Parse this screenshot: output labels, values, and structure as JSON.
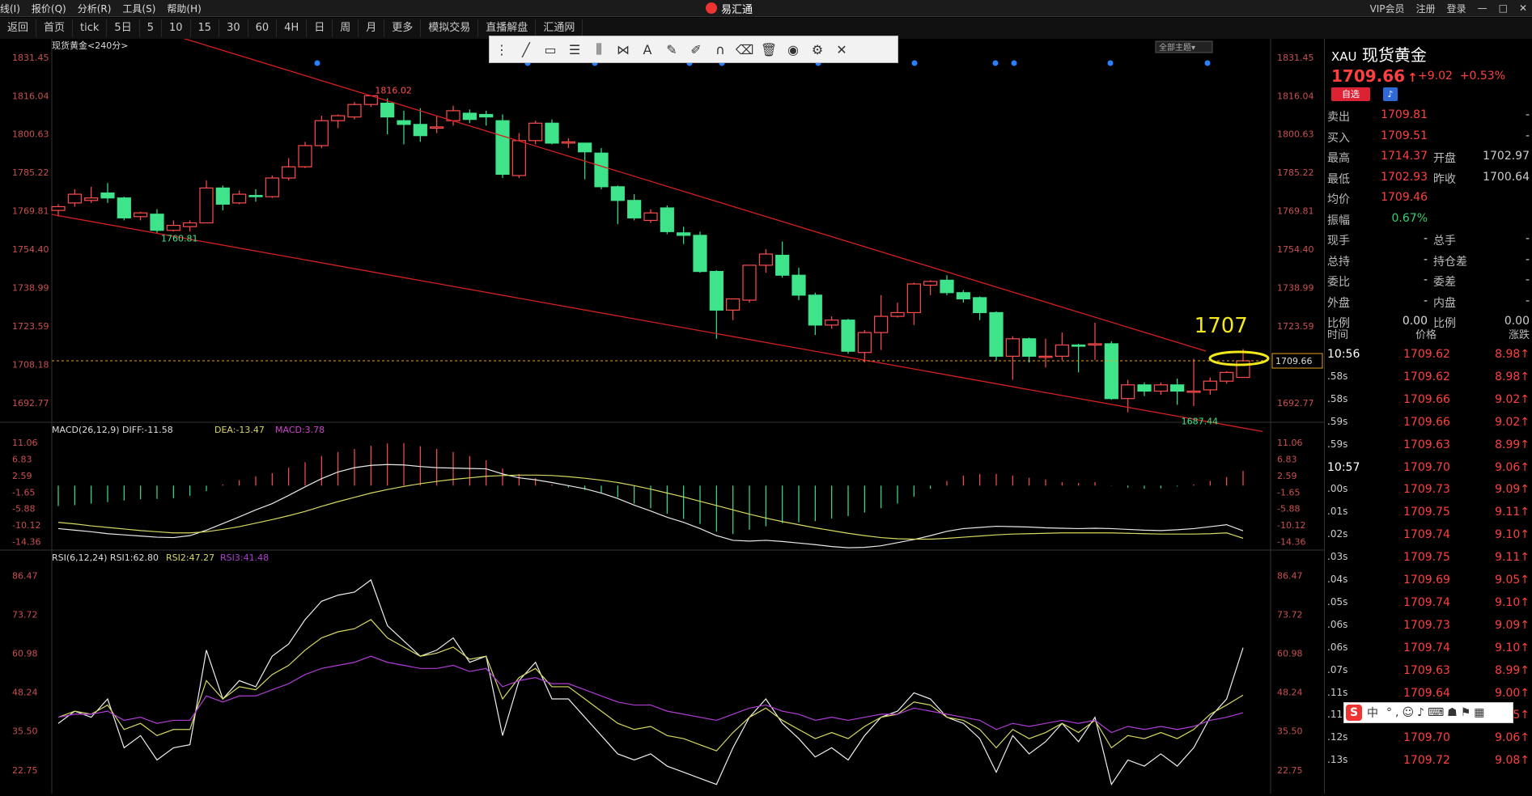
{
  "menu": [
    "线(I)",
    "报价(Q)",
    "分析(R)",
    "工具(S)",
    "帮助(H)"
  ],
  "app_title": "易汇通",
  "top_right": [
    "VIP会员",
    "注册",
    "登录"
  ],
  "toolbar": [
    "返回",
    "首页",
    "tick",
    "5日",
    "5",
    "10",
    "15",
    "30",
    "60",
    "4H",
    "日",
    "周",
    "月",
    "更多",
    "模拟交易",
    "直播解盘",
    "汇通网"
  ],
  "chart": {
    "title": "现货黄金<240分>",
    "main_y_ticks": [
      "1831.45",
      "1816.04",
      "1800.63",
      "1785.22",
      "1769.81",
      "1754.40",
      "1738.99",
      "1723.59",
      "1708.18",
      "1692.77"
    ],
    "current_price_label": "1709.66",
    "annotation": "1707",
    "high_label": "1816.02",
    "low_labels": [
      "1760.81",
      "1687.44"
    ],
    "theme_btn": "全部主题",
    "macd_header": {
      "name": "MACD(26,12,9)",
      "diff": "DIFF:-11.58",
      "dea": "DEA:-13.47",
      "macd": "MACD:3.78"
    },
    "macd_y_ticks": [
      "11.06",
      "6.83",
      "2.59",
      "-1.65",
      "-5.88",
      "-10.12",
      "-14.36"
    ],
    "rsi_header": {
      "name": "RSI(6,12,24)",
      "rsi1": "RSI1:62.80",
      "rsi2": "RSI2:47.27",
      "rsi3": "RSI3:41.48"
    },
    "rsi_y_ticks": [
      "86.47",
      "73.72",
      "60.98",
      "48.24",
      "35.50",
      "22.75"
    ],
    "colors": {
      "up": "#ff4d4d",
      "down": "#3ee38a",
      "line": "#d42020",
      "dea": "#d8d860",
      "rsi3": "#b03cd6"
    }
  },
  "chart_data": {
    "type": "candlestick",
    "title": "现货黄金<240分>",
    "ylim": [
      1685,
      1833
    ],
    "candles": [
      [
        1770.0,
        1771.5,
        1767.5,
        1772.5
      ],
      [
        1773.0,
        1776.5,
        1771.5,
        1778.5
      ],
      [
        1774.0,
        1775.0,
        1773.0,
        1779.5
      ],
      [
        1777.0,
        1775.0,
        1773.0,
        1781.0
      ],
      [
        1775.0,
        1767.0,
        1766.0,
        1775.5
      ],
      [
        1767.5,
        1769.0,
        1766.0,
        1769.5
      ],
      [
        1768.5,
        1762.0,
        1760.81,
        1770.5
      ],
      [
        1762.0,
        1764.0,
        1761.5,
        1766.0
      ],
      [
        1763.5,
        1765.0,
        1761.5,
        1766.0
      ],
      [
        1765.0,
        1779.0,
        1765.0,
        1782.0
      ],
      [
        1779.0,
        1772.5,
        1770.0,
        1780.0
      ],
      [
        1773.0,
        1776.5,
        1772.5,
        1778.0
      ],
      [
        1776.0,
        1775.5,
        1773.5,
        1778.5
      ],
      [
        1775.5,
        1783.0,
        1775.0,
        1784.0
      ],
      [
        1783.0,
        1787.5,
        1782.0,
        1791.0
      ],
      [
        1787.5,
        1796.0,
        1787.0,
        1797.5
      ],
      [
        1796.0,
        1806.0,
        1795.0,
        1808.0
      ],
      [
        1806.0,
        1808.0,
        1803.0,
        1808.5
      ],
      [
        1807.5,
        1812.5,
        1806.5,
        1813.5
      ],
      [
        1812.5,
        1816.0,
        1811.5,
        1816.02
      ],
      [
        1813.0,
        1807.5,
        1800.5,
        1815.0
      ],
      [
        1806.0,
        1804.5,
        1796.5,
        1810.0
      ],
      [
        1804.5,
        1800.0,
        1797.5,
        1811.0
      ],
      [
        1803.0,
        1803.5,
        1801.0,
        1808.0
      ],
      [
        1806.0,
        1810.0,
        1804.0,
        1812.0
      ],
      [
        1809.0,
        1806.5,
        1805.0,
        1810.5
      ],
      [
        1808.5,
        1807.5,
        1804.0,
        1810.0
      ],
      [
        1806.0,
        1784.5,
        1783.0,
        1808.5
      ],
      [
        1784.0,
        1798.0,
        1783.0,
        1801.0
      ],
      [
        1798.0,
        1805.0,
        1796.5,
        1806.0
      ],
      [
        1805.0,
        1797.0,
        1796.5,
        1806.5
      ],
      [
        1797.0,
        1797.5,
        1795.0,
        1799.0
      ],
      [
        1797.0,
        1793.5,
        1782.5,
        1797.0
      ],
      [
        1793.0,
        1779.5,
        1778.5,
        1795.0
      ],
      [
        1779.5,
        1774.0,
        1764.5,
        1780.0
      ],
      [
        1774.0,
        1767.0,
        1766.0,
        1776.5
      ],
      [
        1766.0,
        1769.0,
        1765.0,
        1770.5
      ],
      [
        1771.0,
        1761.5,
        1760.5,
        1772.0
      ],
      [
        1761.0,
        1760.0,
        1756.5,
        1763.5
      ],
      [
        1760.0,
        1745.5,
        1745.0,
        1761.5
      ],
      [
        1745.5,
        1730.0,
        1718.5,
        1746.0
      ],
      [
        1730.0,
        1734.5,
        1726.0,
        1734.5
      ],
      [
        1734.0,
        1748.0,
        1733.0,
        1748.0
      ],
      [
        1748.0,
        1752.5,
        1745.0,
        1754.5
      ],
      [
        1752.0,
        1744.0,
        1743.0,
        1757.5
      ],
      [
        1744.0,
        1736.0,
        1734.0,
        1747.0
      ],
      [
        1736.0,
        1724.0,
        1720.0,
        1737.0
      ],
      [
        1724.0,
        1726.0,
        1722.5,
        1727.5
      ],
      [
        1726.0,
        1713.5,
        1712.5,
        1726.5
      ],
      [
        1713.0,
        1721.0,
        1709.0,
        1722.0
      ],
      [
        1721.0,
        1727.5,
        1714.0,
        1736.0
      ],
      [
        1727.5,
        1729.0,
        1727.0,
        1733.0
      ],
      [
        1729.0,
        1740.5,
        1724.0,
        1741.0
      ],
      [
        1740.0,
        1741.5,
        1736.0,
        1742.0
      ],
      [
        1742.0,
        1737.0,
        1736.0,
        1744.0
      ],
      [
        1737.0,
        1734.5,
        1733.0,
        1738.0
      ],
      [
        1735.0,
        1729.0,
        1726.0,
        1735.5
      ],
      [
        1729.0,
        1711.5,
        1709.5,
        1729.5
      ],
      [
        1711.5,
        1718.5,
        1702.0,
        1719.5
      ],
      [
        1718.5,
        1711.5,
        1709.0,
        1719.0
      ],
      [
        1711.5,
        1711.5,
        1707.0,
        1718.5
      ],
      [
        1711.5,
        1716.0,
        1710.0,
        1721.0
      ],
      [
        1716.0,
        1715.5,
        1705.0,
        1716.5
      ],
      [
        1716.0,
        1716.5,
        1710.0,
        1725.0
      ],
      [
        1716.5,
        1694.5,
        1694.0,
        1717.5
      ],
      [
        1694.5,
        1700.0,
        1689.0,
        1702.0
      ],
      [
        1700.0,
        1697.5,
        1695.5,
        1701.0
      ],
      [
        1697.5,
        1700.0,
        1696.0,
        1701.0
      ],
      [
        1700.0,
        1697.5,
        1692.0,
        1702.5
      ],
      [
        1697.5,
        1697.5,
        1691.5,
        1710.5
      ],
      [
        1698.0,
        1701.5,
        1696.0,
        1703.0
      ],
      [
        1701.5,
        1705.0,
        1700.5,
        1705.5
      ],
      [
        1703.0,
        1709.66,
        1702.93,
        1714.37
      ]
    ],
    "macd": {
      "hist": [
        -5.2,
        -5.0,
        -4.6,
        -4.2,
        -3.8,
        -3.5,
        -3.4,
        -3.2,
        -2.6,
        -1.4,
        0.3,
        1.4,
        2.4,
        3.2,
        4.6,
        6.0,
        7.6,
        8.6,
        9.4,
        10.2,
        10.8,
        10.9,
        10.1,
        9.4,
        8.6,
        7.6,
        6.5,
        4.4,
        3.0,
        1.9,
        0.3,
        -0.5,
        -1.1,
        -1.8,
        -3.0,
        -4.6,
        -5.8,
        -7.2,
        -8.5,
        -9.8,
        -11.8,
        -12.4,
        -11.3,
        -10.4,
        -9.6,
        -9.4,
        -9.1,
        -8.4,
        -7.8,
        -6.9,
        -5.8,
        -4.6,
        -2.8,
        -0.8,
        1.2,
        2.6,
        3.0,
        3.0,
        2.6,
        2.0,
        1.6,
        0.9,
        0.7,
        0.9,
        0.1,
        -0.5,
        -0.8,
        -0.7,
        -0.2,
        0.3,
        1.2,
        2.2,
        3.78
      ],
      "diff": [
        -11.0,
        -11.4,
        -11.8,
        -12.3,
        -12.6,
        -12.9,
        -13.2,
        -13.3,
        -12.8,
        -11.4,
        -9.7,
        -8.0,
        -6.2,
        -4.6,
        -2.5,
        -0.3,
        1.8,
        3.5,
        4.6,
        5.2,
        5.4,
        5.3,
        4.9,
        4.6,
        4.5,
        4.4,
        4.3,
        3.0,
        2.0,
        1.5,
        0.8,
        0.0,
        -0.8,
        -1.9,
        -3.3,
        -5.0,
        -6.5,
        -8.1,
        -9.4,
        -11.0,
        -12.8,
        -14.0,
        -14.2,
        -14.0,
        -14.3,
        -14.7,
        -15.1,
        -15.6,
        -15.9,
        -15.8,
        -15.4,
        -14.6,
        -13.8,
        -12.8,
        -11.7,
        -11.0,
        -10.7,
        -10.4,
        -10.5,
        -10.6,
        -10.8,
        -10.9,
        -11.0,
        -10.9,
        -11.0,
        -11.2,
        -11.4,
        -11.5,
        -11.3,
        -11.0,
        -10.5,
        -10.0,
        -11.58
      ],
      "dea": [
        -9.4,
        -9.8,
        -10.3,
        -10.7,
        -11.1,
        -11.5,
        -11.8,
        -12.1,
        -12.1,
        -11.8,
        -11.2,
        -10.5,
        -9.6,
        -8.7,
        -7.7,
        -6.6,
        -5.3,
        -4.1,
        -3.0,
        -1.9,
        -1.0,
        -0.2,
        0.5,
        1.1,
        1.6,
        2.0,
        2.4,
        2.6,
        2.7,
        2.7,
        2.6,
        2.3,
        1.9,
        1.4,
        0.8,
        0.0,
        -0.9,
        -1.9,
        -2.9,
        -4.0,
        -5.1,
        -6.2,
        -7.3,
        -8.3,
        -9.2,
        -10.0,
        -10.8,
        -11.5,
        -12.2,
        -12.8,
        -13.3,
        -13.6,
        -13.7,
        -13.7,
        -13.5,
        -13.2,
        -12.9,
        -12.6,
        -12.4,
        -12.3,
        -12.2,
        -12.1,
        -12.1,
        -12.1,
        -12.1,
        -12.2,
        -12.3,
        -12.4,
        -12.4,
        -12.4,
        -12.3,
        -12.1,
        -13.47
      ]
    },
    "rsi": {
      "rsi1": [
        38,
        42,
        40,
        46,
        30,
        34,
        26,
        30,
        31,
        62,
        46,
        52,
        50,
        60,
        64,
        72,
        78,
        80,
        81,
        85,
        70,
        65,
        60,
        62,
        66,
        58,
        60,
        34,
        52,
        58,
        46,
        46,
        40,
        34,
        28,
        26,
        28,
        24,
        22,
        20,
        18,
        30,
        40,
        46,
        38,
        33,
        27,
        30,
        26,
        34,
        40,
        42,
        48,
        46,
        40,
        38,
        33,
        22,
        34,
        28,
        32,
        38,
        32,
        40,
        18,
        26,
        24,
        28,
        24,
        30,
        40,
        46,
        62.8
      ],
      "rsi2": [
        40,
        42,
        41,
        44,
        36,
        38,
        34,
        36,
        36,
        52,
        46,
        50,
        49,
        54,
        57,
        62,
        66,
        68,
        69,
        72,
        66,
        63,
        60,
        61,
        63,
        59,
        60,
        46,
        53,
        56,
        50,
        50,
        46,
        42,
        38,
        36,
        37,
        34,
        33,
        31,
        29,
        35,
        40,
        43,
        39,
        36,
        33,
        35,
        33,
        37,
        40,
        41,
        45,
        44,
        40,
        39,
        36,
        30,
        36,
        33,
        35,
        38,
        35,
        39,
        30,
        34,
        33,
        35,
        33,
        36,
        41,
        44,
        47.27
      ],
      "rsi3": [
        40,
        41,
        41,
        42,
        39,
        40,
        38,
        39,
        39,
        47,
        45,
        47,
        47,
        49,
        51,
        54,
        56,
        57,
        58,
        60,
        58,
        57,
        56,
        56,
        57,
        55,
        56,
        50,
        52,
        53,
        51,
        51,
        49,
        47,
        45,
        44,
        44,
        42,
        41,
        40,
        39,
        41,
        43,
        44,
        42,
        41,
        39,
        40,
        39,
        40,
        41,
        41,
        43,
        42,
        41,
        40,
        39,
        36,
        38,
        37,
        38,
        39,
        38,
        39,
        35,
        37,
        36,
        37,
        36,
        37,
        39,
        40,
        41.48
      ]
    }
  },
  "quote": {
    "symbol": "XAU",
    "name": "现货黄金",
    "price": "1709.66",
    "arrow": "↑",
    "change": "+9.02",
    "change_pct": "+0.53%",
    "fav_btn": "自选",
    "rows": [
      {
        "l1": "卖出",
        "v1": "1709.81",
        "c1": "red",
        "l2": "",
        "v2": "-"
      },
      {
        "l1": "买入",
        "v1": "1709.51",
        "c1": "red",
        "l2": "",
        "v2": "-"
      },
      {
        "l1": "最高",
        "v1": "1714.37",
        "c1": "red",
        "l2": "开盘",
        "v2": "1702.97",
        "c2": "red"
      },
      {
        "l1": "最低",
        "v1": "1702.93",
        "c1": "red",
        "l2": "昨收",
        "v2": "1700.64",
        "c2": "white"
      },
      {
        "l1": "均价",
        "v1": "1709.46",
        "c1": "red",
        "l2": "",
        "v2": ""
      },
      {
        "l1": "振幅",
        "v1": "0.67%",
        "c1": "green",
        "l2": "",
        "v2": ""
      },
      {
        "l1": "现手",
        "v1": "-",
        "c1": "white",
        "l2": "总手",
        "v2": "-"
      },
      {
        "l1": "总持",
        "v1": "-",
        "c1": "white",
        "l2": "持仓差",
        "v2": "-"
      },
      {
        "l1": "委比",
        "v1": "-",
        "c1": "white",
        "l2": "委差",
        "v2": "-"
      },
      {
        "l1": "外盘",
        "v1": "-",
        "c1": "white",
        "l2": "内盘",
        "v2": "-"
      },
      {
        "l1": "比例",
        "v1": "0.00",
        "c1": "white",
        "l2": "比例",
        "v2": "0.00"
      }
    ],
    "ticks_header": [
      "时间",
      "价格",
      "涨跌"
    ],
    "ticks": [
      {
        "t": "10:56",
        "p": "1709.62",
        "c": "8.98"
      },
      {
        "t": ".58s",
        "p": "1709.62",
        "c": "8.98"
      },
      {
        "t": ".58s",
        "p": "1709.66",
        "c": "9.02"
      },
      {
        "t": ".59s",
        "p": "1709.66",
        "c": "9.02"
      },
      {
        "t": ".59s",
        "p": "1709.63",
        "c": "8.99"
      },
      {
        "t": "10:57",
        "p": "1709.70",
        "c": "9.06"
      },
      {
        "t": ".00s",
        "p": "1709.73",
        "c": "9.09"
      },
      {
        "t": ".01s",
        "p": "1709.75",
        "c": "9.11"
      },
      {
        "t": ".02s",
        "p": "1709.74",
        "c": "9.10"
      },
      {
        "t": ".03s",
        "p": "1709.75",
        "c": "9.11"
      },
      {
        "t": ".04s",
        "p": "1709.69",
        "c": "9.05"
      },
      {
        "t": ".05s",
        "p": "1709.74",
        "c": "9.10"
      },
      {
        "t": ".06s",
        "p": "1709.73",
        "c": "9.09"
      },
      {
        "t": ".06s",
        "p": "1709.74",
        "c": "9.10"
      },
      {
        "t": ".07s",
        "p": "1709.63",
        "c": "8.99"
      },
      {
        "t": ".11s",
        "p": "1709.64",
        "c": "9.00"
      },
      {
        "t": ".11s",
        "p": "1709.69",
        "c": "9.05"
      },
      {
        "t": ".12s",
        "p": "1709.70",
        "c": "9.06"
      },
      {
        "t": ".13s",
        "p": "1709.72",
        "c": "9.08"
      }
    ]
  },
  "ime": {
    "logo": "S",
    "label": "中"
  }
}
